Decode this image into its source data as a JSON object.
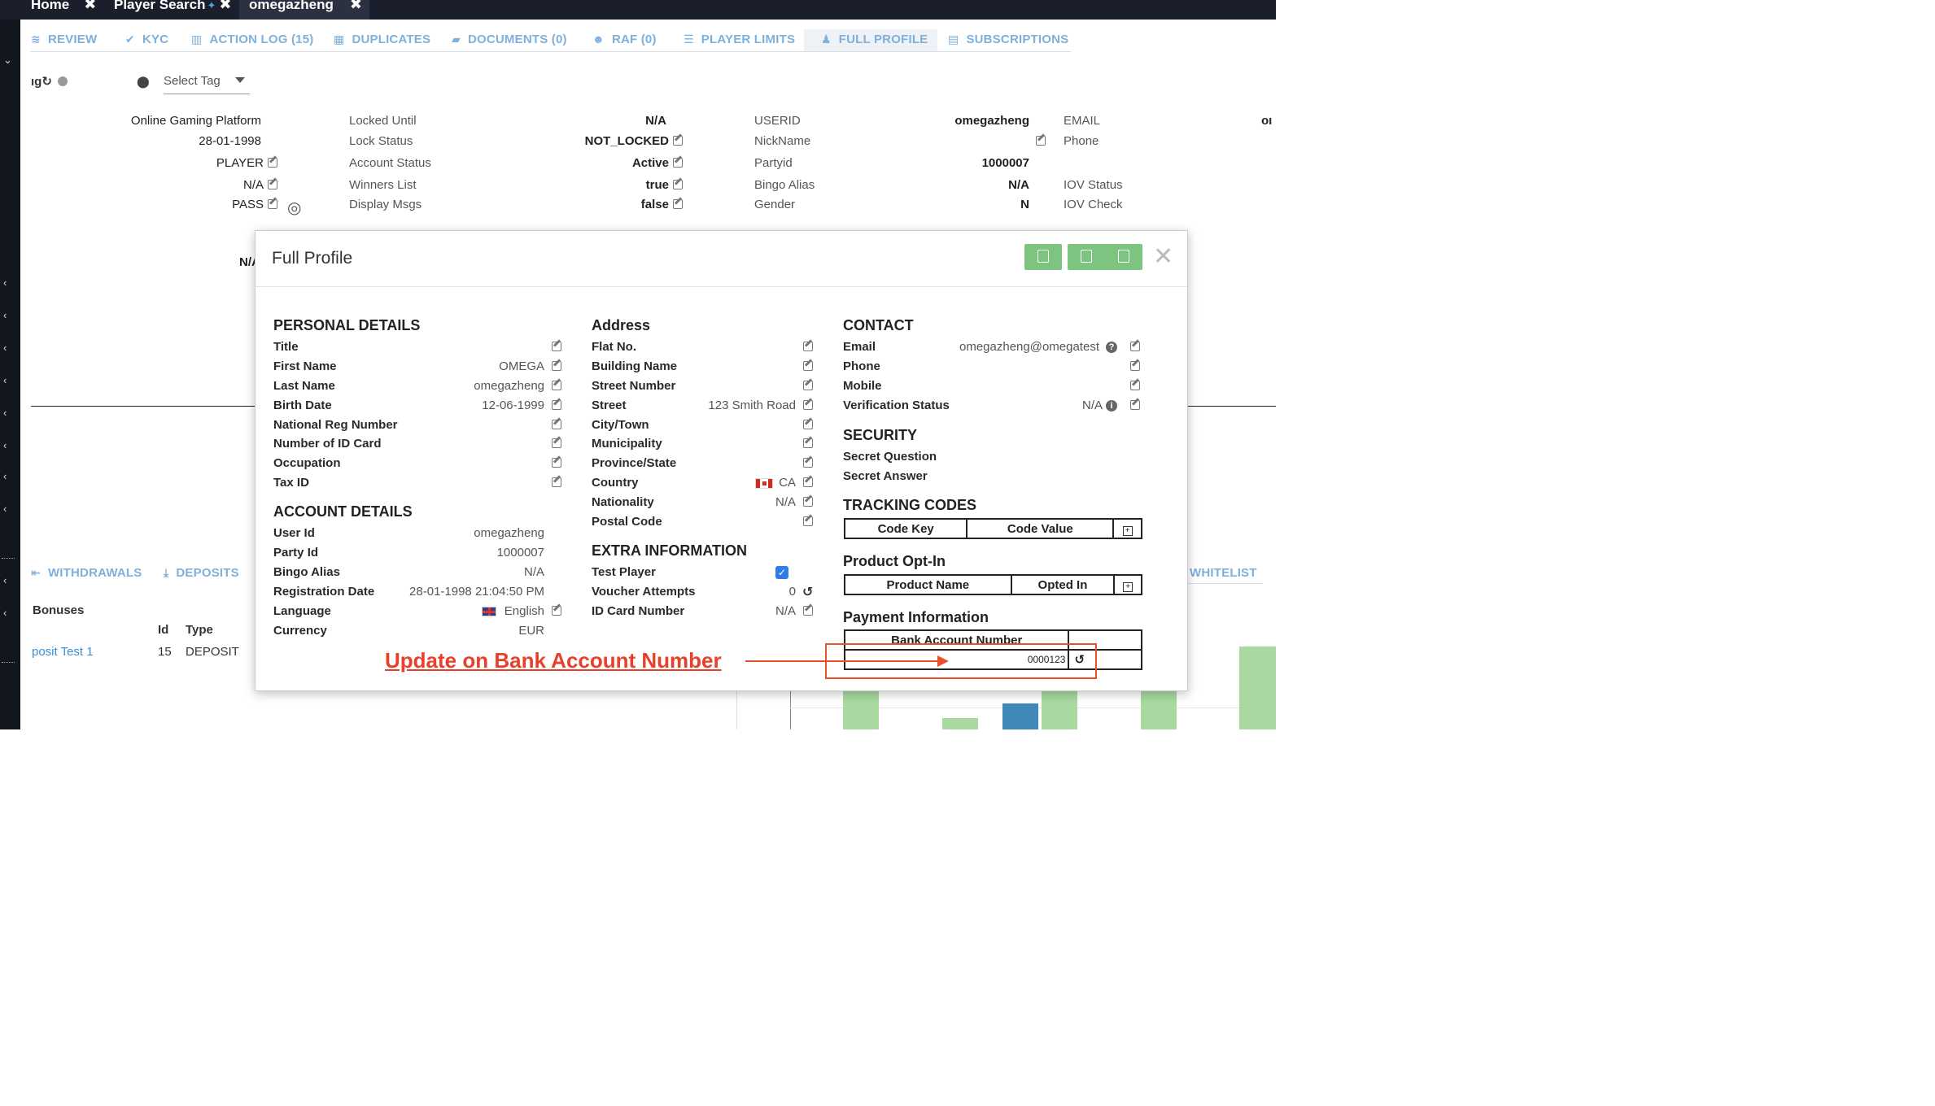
{
  "top_tabs": [
    {
      "label": "Home",
      "close": "✖"
    },
    {
      "label": "Player Search",
      "close": "✖"
    },
    {
      "label": "omegazheng",
      "close": "✖"
    }
  ],
  "nav_tabs": [
    {
      "label": "REVIEW",
      "icon": "review-icon"
    },
    {
      "label": "KYC",
      "icon": "check-circle-icon"
    },
    {
      "label": "ACTION LOG (15)",
      "icon": "map-icon"
    },
    {
      "label": "DUPLICATES",
      "icon": "grid-icon"
    },
    {
      "label": "DOCUMENTS (0)",
      "icon": "folder-icon"
    },
    {
      "label": "RAF (0)",
      "icon": "users-icon"
    },
    {
      "label": "PLAYER LIMITS",
      "icon": "list-icon"
    },
    {
      "label": "FULL PROFILE",
      "icon": "user-icon"
    },
    {
      "label": "SUBSCRIPTIONS",
      "icon": "file-icon"
    }
  ],
  "tag_bar": {
    "partial_label": "ıg",
    "select_placeholder": "Select Tag"
  },
  "header_info": {
    "col1": [
      "Online Gaming Platform",
      "28-01-1998",
      "PLAYER",
      "N/A",
      "PASS"
    ],
    "col2_labels": [
      "Locked Until",
      "Lock Status",
      "Account Status",
      "Winners List",
      "Display Msgs"
    ],
    "col2_values": [
      "N/A",
      "NOT_LOCKED",
      "Active",
      "true",
      "false"
    ],
    "col3_labels": [
      "USERID",
      "NickName",
      "Partyid",
      "Bingo Alias",
      "Gender"
    ],
    "col3_values": [
      "omegazheng",
      "",
      "1000007",
      "N/A",
      "N"
    ],
    "col4_labels": [
      "EMAIL",
      "Phone",
      "",
      "IOV Status",
      "IOV Check"
    ],
    "col5_partial": "oı",
    "partial_na": "N/A"
  },
  "background_lower": {
    "tabs": [
      "WITHDRAWALS",
      "DEPOSITS",
      "WHITELIST"
    ],
    "bonuses_title": "Bonuses",
    "table_headers": [
      "Id",
      "Type"
    ],
    "row": {
      "name": "posit Test 1",
      "id": "15",
      "type": "DEPOSIT"
    }
  },
  "modal": {
    "title": "Full Profile",
    "personal_details": {
      "heading": "PERSONAL DETAILS",
      "fields": [
        {
          "label": "Title",
          "value": ""
        },
        {
          "label": "First Name",
          "value": "OMEGA"
        },
        {
          "label": "Last Name",
          "value": "omegazheng"
        },
        {
          "label": "Birth Date",
          "value": "12-06-1999"
        },
        {
          "label": "National Reg Number",
          "value": ""
        },
        {
          "label": "Number of ID Card",
          "value": ""
        },
        {
          "label": "Occupation",
          "value": ""
        },
        {
          "label": "Tax ID",
          "value": ""
        }
      ]
    },
    "account_details": {
      "heading": "ACCOUNT DETAILS",
      "fields": [
        {
          "label": "User Id",
          "value": "omegazheng"
        },
        {
          "label": "Party Id",
          "value": "1000007"
        },
        {
          "label": "Bingo Alias",
          "value": "N/A"
        },
        {
          "label": "Registration Date",
          "value": "28-01-1998 21:04:50 PM"
        },
        {
          "label": "Language",
          "value": "English"
        },
        {
          "label": "Currency",
          "value": "EUR"
        }
      ]
    },
    "address": {
      "heading": "Address",
      "fields": [
        {
          "label": "Flat No.",
          "value": ""
        },
        {
          "label": "Building Name",
          "value": ""
        },
        {
          "label": "Street Number",
          "value": ""
        },
        {
          "label": "Street",
          "value": "123 Smith Road"
        },
        {
          "label": "City/Town",
          "value": ""
        },
        {
          "label": "Municipality",
          "value": ""
        },
        {
          "label": "Province/State",
          "value": ""
        },
        {
          "label": "Country",
          "value": "CA"
        },
        {
          "label": "Nationality",
          "value": "N/A"
        },
        {
          "label": "Postal Code",
          "value": ""
        }
      ]
    },
    "extra_information": {
      "heading": "EXTRA INFORMATION",
      "fields": [
        {
          "label": "Test Player",
          "value": "checked"
        },
        {
          "label": "Voucher Attempts",
          "value": "0"
        },
        {
          "label": "ID Card Number",
          "value": "N/A"
        }
      ]
    },
    "contact": {
      "heading": "CONTACT",
      "fields": [
        {
          "label": "Email",
          "value": "omegazheng@omegatest"
        },
        {
          "label": "Phone",
          "value": ""
        },
        {
          "label": "Mobile",
          "value": ""
        },
        {
          "label": "Verification Status",
          "value": "N/A"
        }
      ]
    },
    "security": {
      "heading": "SECURITY",
      "fields": [
        {
          "label": "Secret Question",
          "value": ""
        },
        {
          "label": "Secret Answer",
          "value": ""
        }
      ]
    },
    "tracking_codes": {
      "heading": "TRACKING CODES",
      "columns": [
        "Code Key",
        "Code Value"
      ]
    },
    "product_opt_in": {
      "heading": "Product Opt-In",
      "columns": [
        "Product Name",
        "Opted In"
      ]
    },
    "payment_information": {
      "heading": "Payment Information",
      "column": "Bank Account Number",
      "value": "0000123"
    }
  },
  "annotation": "Update on Bank Account Number",
  "colors": {
    "nav_blue": "#7fb0dc",
    "green_button": "#7cc47f",
    "annotation_red": "#e8402a"
  }
}
